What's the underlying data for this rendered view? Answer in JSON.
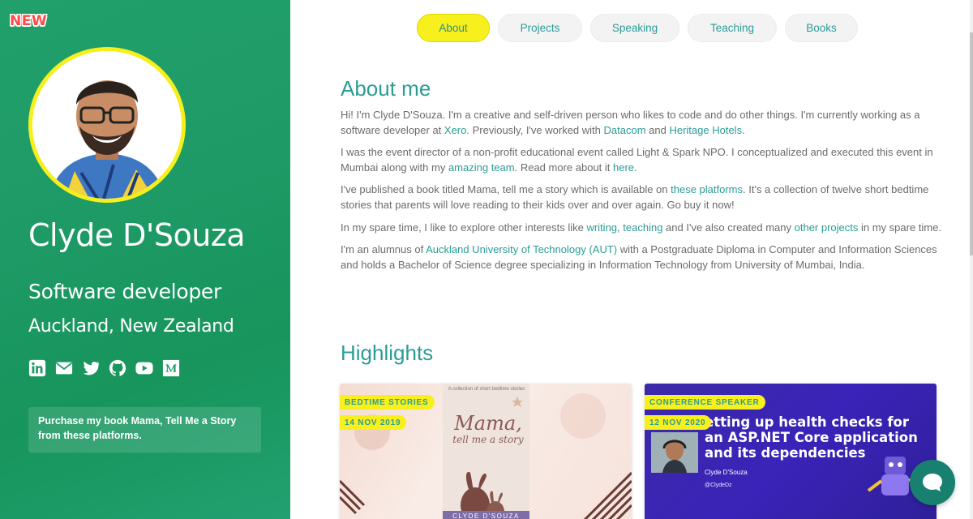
{
  "sidebar": {
    "badge": "NEW",
    "name": "Clyde D'Souza",
    "role": "Software developer",
    "location": "Auckland, New Zealand",
    "socials": [
      "linkedin-icon",
      "email-icon",
      "twitter-icon",
      "github-icon",
      "youtube-icon",
      "medium-icon"
    ],
    "promo": "Purchase my book Mama, Tell Me a Story from these platforms."
  },
  "nav": {
    "tabs": [
      {
        "label": "About",
        "active": true
      },
      {
        "label": "Projects",
        "active": false
      },
      {
        "label": "Speaking",
        "active": false
      },
      {
        "label": "Teaching",
        "active": false
      },
      {
        "label": "Books",
        "active": false
      }
    ]
  },
  "about": {
    "title": "About me",
    "p1": {
      "t1": "Hi! I'm Clyde D'Souza. I'm a creative and self-driven person who likes to code and do other things. I'm currently working as a software developer at ",
      "l1": "Xero",
      "t2": ". Previously, I've worked with ",
      "l2": "Datacom",
      "t3": " and ",
      "l3": "Heritage Hotels",
      "t4": "."
    },
    "p2": {
      "t1": "I was the event director of a non-profit educational event called Light & Spark NPO. I conceptualized and executed this event in Mumbai along with my ",
      "l1": "amazing team",
      "t2": ". Read more about it ",
      "l2": "here",
      "t3": "."
    },
    "p3": {
      "t1": "I've published a book titled Mama, tell me a story which is available on ",
      "l1": "these platforms",
      "t2": ". It's a collection of twelve short bedtime stories that parents will love reading to their kids over and over again. Go buy it now!"
    },
    "p4": {
      "t1": "In my spare time, I like to explore other interests like ",
      "l1": "writing",
      "t2": ", ",
      "l2": "teaching",
      "t3": " and I've also created many ",
      "l3": "other projects",
      "t4": " in my spare time."
    },
    "p5": {
      "t1": "I'm an alumnus of ",
      "l1": "Auckland University of Technology (AUT)",
      "t2": " with a Postgraduate Diploma in Computer and Information Sciences and holds a Bachelor of Science degree specializing in Information Technology from University of Mumbai, India."
    }
  },
  "highlights": {
    "title": "Highlights",
    "cards": [
      {
        "category": "BEDTIME STORIES",
        "date": "14 NOV 2019",
        "cover_small": "A collection of short bedtime stories",
        "cover_title_1": "Mama,",
        "cover_title_2": "tell me a story",
        "cover_author": "CLYDE D'SOUZA"
      },
      {
        "category": "CONFERENCE SPEAKER",
        "date": "12 NOV 2020",
        "talk_title": "etting up health checks for an ASP.NET Core application and its dependencies",
        "speaker": "Clyde D'Souza",
        "handle": "@ClydeDz"
      }
    ]
  },
  "colors": {
    "sidebar_green": "#1e9a66",
    "accent_teal": "#2b9c95",
    "accent_yellow": "#f8f01c",
    "body_text": "#6b6b6b"
  }
}
